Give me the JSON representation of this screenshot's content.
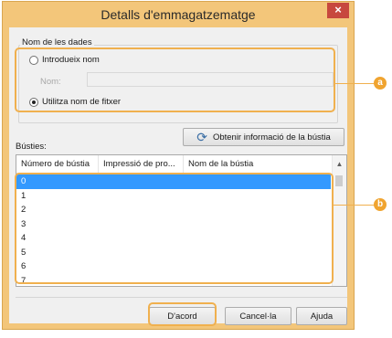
{
  "dialog": {
    "title": "Detalls d'emmagatzematge",
    "close_label": "×"
  },
  "data_name_group": {
    "label": "Nom de les dades",
    "option_enter_name": "Introdueix nom",
    "name_label": "Nom:",
    "name_value": "",
    "option_use_filename": "Utilitza nom de fitxer",
    "selected_option": "Utilitza nom de fitxer"
  },
  "mailboxes": {
    "label": "Bústies:",
    "get_info_button": "Obtenir informació de la bústia",
    "columns": [
      "Número de bústia",
      "Impressió de pro...",
      "Nom de la bústia"
    ],
    "rows": [
      "0",
      "1",
      "2",
      "3",
      "4",
      "5",
      "6",
      "7"
    ],
    "selected_row": "0"
  },
  "buttons": {
    "ok": "D'acord",
    "cancel": "Cancel·la",
    "help": "Ajuda"
  },
  "callouts": {
    "a": "a",
    "b": "b"
  },
  "colors": {
    "frame": "#f3c67a",
    "highlight": "#f0b04e",
    "selection": "#3399ff",
    "close": "#c7483e"
  }
}
